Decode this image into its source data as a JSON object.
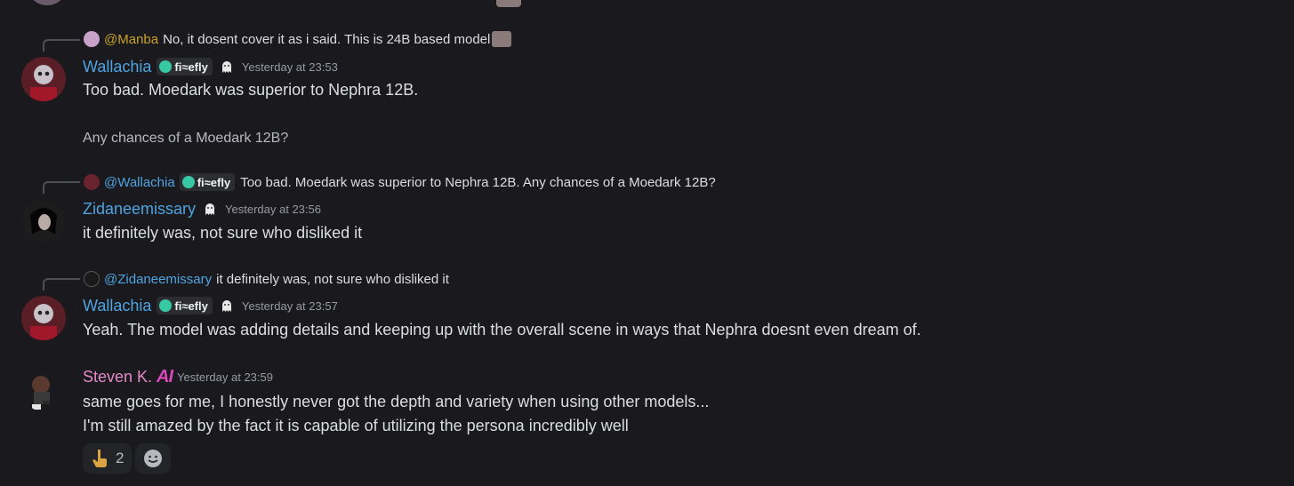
{
  "messages": [
    {
      "reply": {
        "mention": "@Manba",
        "text": "No, it dosent cover it as i said. This is 24B based model",
        "mention_color": "#c9a227"
      },
      "author": "Wallachia",
      "author_color": "#4fa3e0",
      "tag": "fi≈efly",
      "timestamp": "Yesterday at 23:53",
      "lines": [
        "Too bad. Moedark was superior to Nephra 12B.",
        "Any chances of a Moedark 12B?"
      ]
    },
    {
      "reply": {
        "mention": "@Wallachia",
        "tag": "fi≈efly",
        "text": "Too bad. Moedark was superior to Nephra 12B.  Any chances of a Moedark 12B?",
        "mention_color": "#4fa3e0"
      },
      "author": "Zidaneemissary",
      "author_color": "#4fa3e0",
      "timestamp": "Yesterday at 23:56",
      "lines": [
        "it definitely was, not sure who disliked it"
      ]
    },
    {
      "reply": {
        "mention": "@Zidaneemissary",
        "text": "it definitely was, not sure who disliked it",
        "mention_color": "#4fa3e0"
      },
      "author": "Wallachia",
      "author_color": "#4fa3e0",
      "tag": "fi≈efly",
      "timestamp": "Yesterday at 23:57",
      "lines": [
        "Yeah. The model was adding details and keeping up with the overall scene in ways that Nephra doesnt even dream of."
      ]
    },
    {
      "author": "Steven K.",
      "author_color": "#e48ac8",
      "badge": "AI",
      "timestamp": "Yesterday at 23:59",
      "lines": [
        "same goes for me, I honestly never got the depth and variety when using other models...",
        "I'm still amazed by the fact it is capable of utilizing the persona incredibly well"
      ]
    }
  ],
  "reactions": [
    {
      "icon": "pointing-hand-emoji",
      "count": "2"
    },
    {
      "icon": "add-reaction-icon"
    }
  ],
  "colors": {
    "background": "#1a1a1e",
    "text": "#dbdee1",
    "timestamp": "#949ba4"
  }
}
